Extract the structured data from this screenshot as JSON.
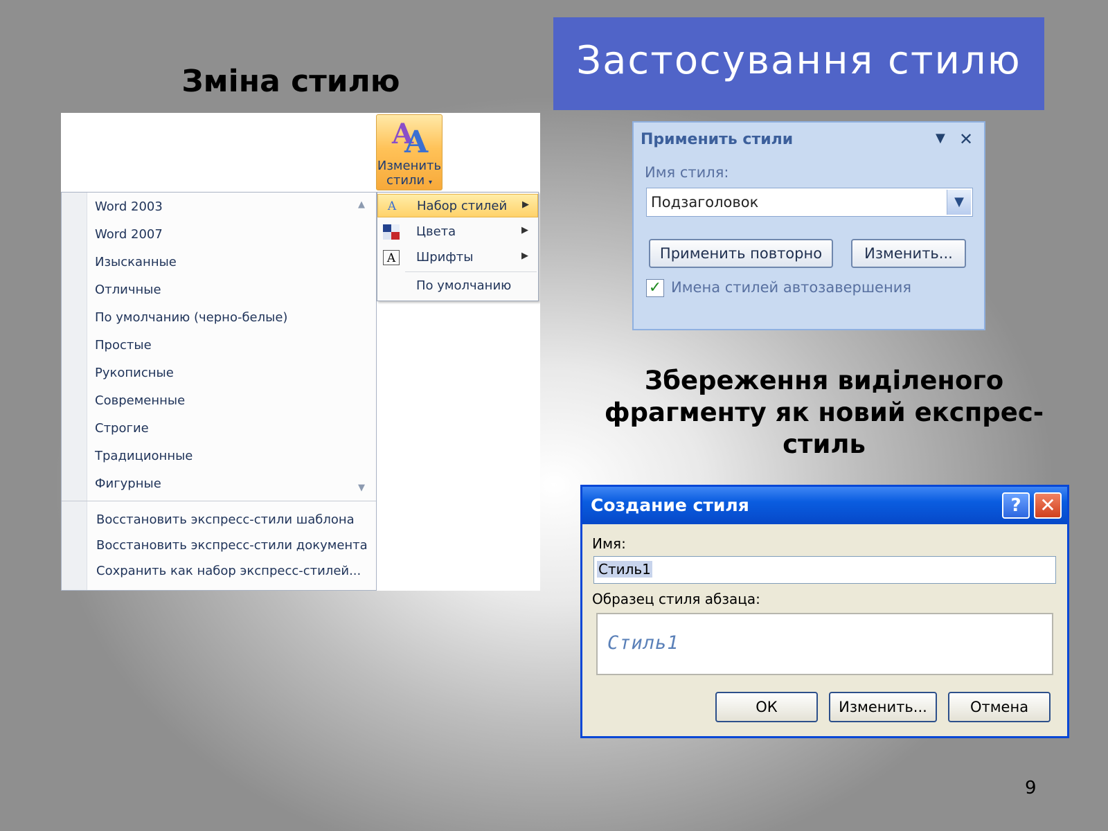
{
  "headings": {
    "change_style": "Зміна стилю",
    "apply_style": "Застосування  стилю",
    "save_fragment_line1": "Збереження виділеного",
    "save_fragment_line2": "фрагменту як новий експрес-",
    "save_fragment_line3": "стиль"
  },
  "page_number": "9",
  "colors": {
    "title_box": "#5064c8",
    "xp_title": "#0a5de0",
    "ribbon_orange": "#ffc258"
  },
  "ribbon": {
    "button_label_line1": "Изменить",
    "button_label_line2": "стили",
    "button_dropdown_icon": "chevron-down-icon"
  },
  "styles_list": {
    "items": [
      "Word 2003",
      "Word 2007",
      "Изысканные",
      "Отличные",
      "По умолчанию (черно-белые)",
      "Простые",
      "Рукописные",
      "Современные",
      "Строгие",
      "Традиционные",
      "Фигурные"
    ],
    "commands": [
      "Восстановить экспресс-стили шаблона",
      "Восстановить экспресс-стили документа",
      "Сохранить как набор экспресс-стилей..."
    ]
  },
  "submenu": {
    "items": [
      {
        "label": "Набор стилей",
        "icon": "style-set-icon",
        "has_arrow": true,
        "highlighted": true
      },
      {
        "label": "Цвета",
        "icon": "colors-icon",
        "has_arrow": true
      },
      {
        "label": "Шрифты",
        "icon": "fonts-icon",
        "has_arrow": true
      },
      {
        "label": "По умолчанию",
        "icon": "",
        "has_arrow": false
      }
    ]
  },
  "apply_panel": {
    "title": "Применить стили",
    "name_label": "Имя стиля:",
    "name_value": "Подзаголовок",
    "reapply_button": "Применить повторно",
    "modify_button": "Изменить...",
    "autocomplete_label": "Имена стилей автозавершения",
    "autocomplete_checked": true
  },
  "create_dialog": {
    "title": "Создание стиля",
    "name_label": "Имя:",
    "name_value": "Стиль1",
    "sample_label": "Образец стиля абзаца:",
    "sample_text": "Стиль1",
    "ok_button": "ОК",
    "modify_button": "Изменить...",
    "cancel_button": "Отмена"
  }
}
